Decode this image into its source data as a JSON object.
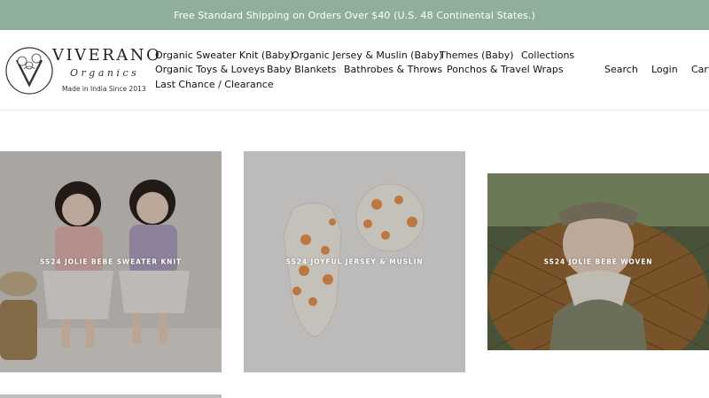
{
  "announcement": "Free Standard Shipping on Orders Over $40 (U.S. 48 Continental States.)",
  "logo": {
    "name": "VIVERANO",
    "sub": "Organics",
    "tagline": "Made in India Since 2013"
  },
  "nav": {
    "items": [
      "Organic Sweater Knit (Baby)",
      "Organic Jersey & Muslin (Baby)",
      "Themes (Baby)",
      "Collections",
      "Organic Toys & Loveys",
      "Baby Blankets",
      "Bathrobes & Throws",
      "Ponchos & Travel Wraps",
      "Last Chance / Clearance"
    ]
  },
  "utility": {
    "search": "Search",
    "login": "Login",
    "cart": "Cart"
  },
  "collections": [
    {
      "label": "SS24 JOLIE BEBE SWEATER KNIT"
    },
    {
      "label": "SS24 JOYFUL JERSEY & MUSLIN"
    },
    {
      "label": "SS24 JOLIE BEBE WOVEN"
    }
  ],
  "colors": {
    "announcement_bg": "#8fae9c",
    "tile_overlay": "#000000"
  }
}
